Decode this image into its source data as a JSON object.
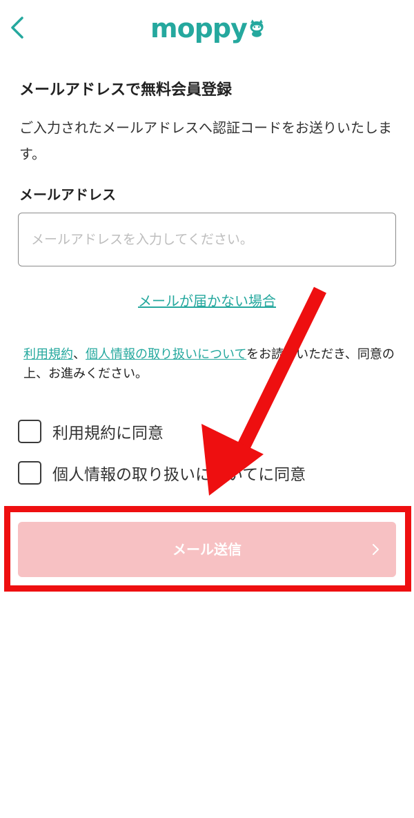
{
  "header": {
    "back_icon": "chevron-left-icon",
    "logo_text": "moppy",
    "logo_mascot": "raccoon-mascot-icon",
    "brand_color": "#25a89e"
  },
  "form": {
    "title": "メールアドレスで無料会員登録",
    "description": "ご入力されたメールアドレスへ認証コードをお送りいたします。",
    "email_label": "メールアドレス",
    "email_placeholder": "メールアドレスを入力してください。",
    "email_value": "",
    "help_link": "メールが届かない場合",
    "agree": {
      "terms_link": "利用規約",
      "separator": "、",
      "privacy_link": "個人情報の取り扱いについて",
      "suffix": "をお読みいただき、同意の上、お進みください。"
    },
    "checkboxes": [
      {
        "label": "利用規約に同意",
        "checked": false
      },
      {
        "label": "個人情報の取り扱いについてに同意",
        "checked": false
      }
    ],
    "submit_label": "メール送信",
    "submit_icon": "chevron-right-icon",
    "submit_color": "#f7c1c3"
  },
  "annotation": {
    "arrow_color": "#ee0f10",
    "highlight_color": "#ee0f10"
  }
}
